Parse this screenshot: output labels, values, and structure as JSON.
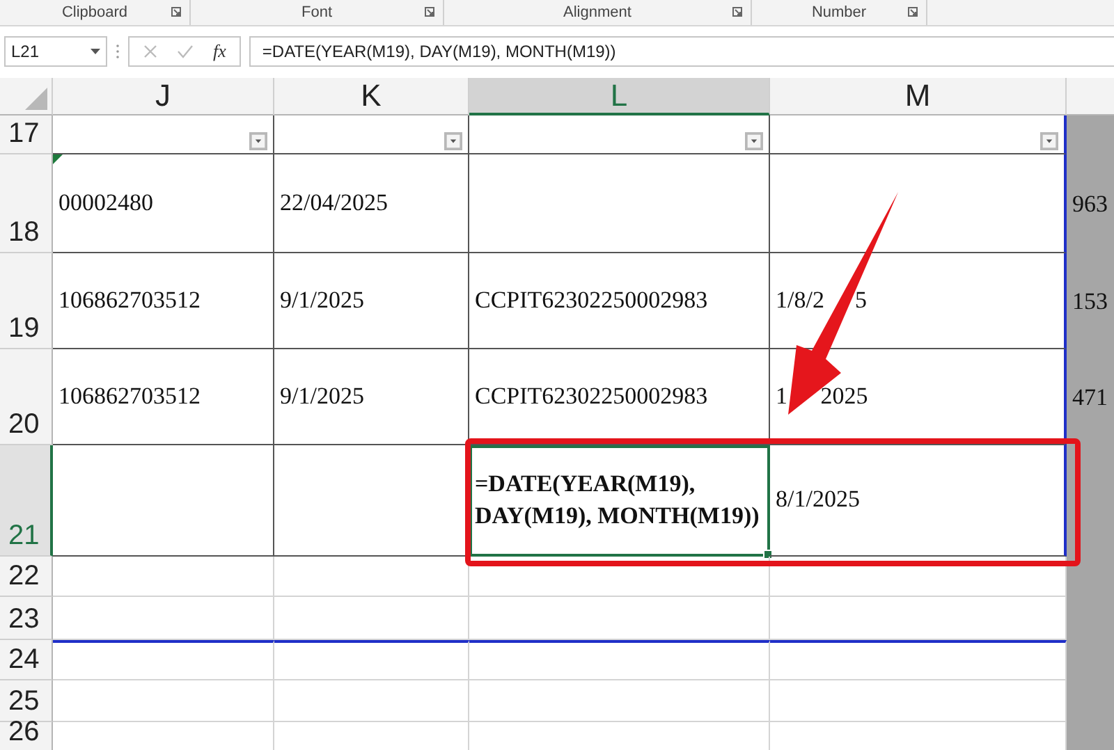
{
  "ribbon_groups": [
    {
      "label": "Clipboard"
    },
    {
      "label": "Font"
    },
    {
      "label": "Alignment"
    },
    {
      "label": "Number"
    }
  ],
  "formula_bar": {
    "name_box": "L21",
    "fx": "fx",
    "formula": "=DATE(YEAR(M19), DAY(M19), MONTH(M19))"
  },
  "columns": [
    {
      "label": "J",
      "selected": false
    },
    {
      "label": "K",
      "selected": false
    },
    {
      "label": "L",
      "selected": true
    },
    {
      "label": "M",
      "selected": false
    }
  ],
  "rows": [
    {
      "label": "17",
      "selected": false,
      "cells": [
        {
          "kind": "filter",
          "active": false
        },
        {
          "kind": "filter",
          "active": false
        },
        {
          "kind": "filter",
          "active": false
        },
        {
          "kind": "filter",
          "active": false
        }
      ]
    },
    {
      "label": "18",
      "selected": false,
      "side": "963",
      "cells": [
        {
          "kind": "text",
          "text": "00002480",
          "flag": true,
          "bold": false,
          "active": false
        },
        {
          "kind": "text",
          "text": "22/04/2025",
          "flag": false,
          "bold": false,
          "active": false
        },
        {
          "kind": "blank",
          "active": false
        },
        {
          "kind": "blank",
          "active": false
        }
      ]
    },
    {
      "label": "19",
      "selected": false,
      "side": "153",
      "cells": [
        {
          "kind": "text",
          "text": "106862703512",
          "flag": false,
          "bold": false,
          "active": false
        },
        {
          "kind": "text",
          "text": "9/1/2025",
          "flag": false,
          "bold": false,
          "active": false
        },
        {
          "kind": "text",
          "text": "CCPIT62302250002983",
          "flag": false,
          "bold": false,
          "active": false
        },
        {
          "kind": "covered",
          "parts": [
            "1/8/2",
            "5"
          ],
          "flag": false,
          "bold": false,
          "active": false
        }
      ]
    },
    {
      "label": "20",
      "selected": false,
      "side": "471",
      "cells": [
        {
          "kind": "text",
          "text": "106862703512",
          "flag": false,
          "bold": false,
          "active": false
        },
        {
          "kind": "text",
          "text": "9/1/2025",
          "flag": false,
          "bold": false,
          "active": false
        },
        {
          "kind": "text",
          "text": "CCPIT62302250002983",
          "flag": false,
          "bold": false,
          "active": false
        },
        {
          "kind": "covered",
          "parts": [
            "1",
            "2025"
          ],
          "flag": false,
          "bold": false,
          "active": false
        }
      ]
    },
    {
      "label": "21",
      "selected": true,
      "cells": [
        {
          "kind": "blank",
          "active": false
        },
        {
          "kind": "blank",
          "active": false
        },
        {
          "kind": "text",
          "text": "=DATE(YEAR(M19), DAY(M19), MONTH(M19))",
          "flag": false,
          "bold": true,
          "active": true
        },
        {
          "kind": "text",
          "text": "8/1/2025",
          "flag": false,
          "bold": false,
          "active": false
        }
      ]
    },
    {
      "label": "22",
      "selected": false,
      "cells": []
    },
    {
      "label": "23",
      "selected": false,
      "cells": []
    },
    {
      "label": "24",
      "selected": false,
      "cells": []
    },
    {
      "label": "25",
      "selected": false,
      "cells": []
    },
    {
      "label": "26",
      "selected": false,
      "cells": []
    }
  ]
}
